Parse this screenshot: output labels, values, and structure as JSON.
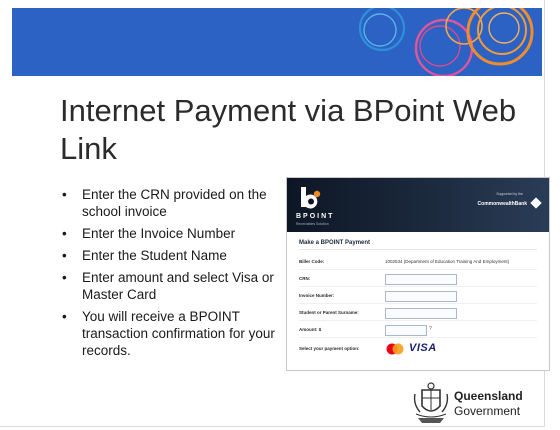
{
  "slide": {
    "title": "Internet Payment via BPoint Web Link",
    "bullet_glyph": "•",
    "bullets": [
      "Enter the CRN provided on the school invoice",
      "Enter the Invoice Number",
      "Enter the Student Name",
      "Enter amount and select Visa or Master Card",
      "You will receive a BPOINT transaction confirmation for your records."
    ],
    "banner_color": "#2b62c3"
  },
  "screenshot": {
    "brand": "BPOINT",
    "brand_tagline": "Receivables Solution",
    "supported_by": "Supported by the",
    "bank_name": "CommonwealthBank",
    "form_title": "Make a BPOINT Payment",
    "fields": {
      "biller_label": "Biller Code:",
      "biller_value": "1002534  (Department of Education Training And Employment)",
      "crn_label": "CRN:",
      "invoice_label": "Invoice Number:",
      "student_label": "Student or Parent Surname:",
      "amount_label": "Amount: $",
      "payment_label": "Select your payment option:",
      "amount_help": "?"
    },
    "card_brand": "VISA"
  },
  "footer": {
    "logo_line1": "Queensland",
    "logo_line2": "Government"
  }
}
